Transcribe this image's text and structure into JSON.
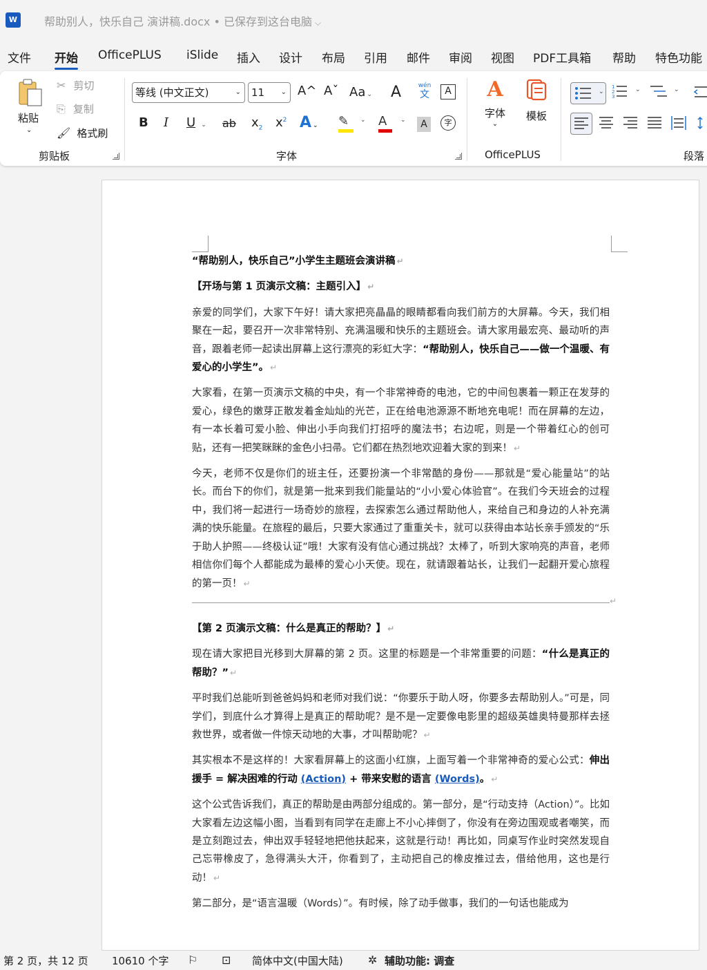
{
  "app": {
    "logo_text": "W",
    "doc_title": "帮助别人，快乐自己 演讲稿.docx • 已保存到这台电脑",
    "title_chevron": "⌵"
  },
  "menu": {
    "tabs": [
      "文件",
      "开始",
      "OfficePLUS",
      "iSlide",
      "插入",
      "设计",
      "布局",
      "引用",
      "邮件",
      "审阅",
      "视图",
      "PDF工具箱",
      "帮助",
      "特色功能"
    ],
    "active": "开始"
  },
  "ribbon": {
    "clipboard": {
      "paste": "粘贴",
      "cut": "剪切",
      "copy": "复制",
      "format_painter": "格式刷",
      "group_label": "剪贴板"
    },
    "font": {
      "font_name": "等线 (中文正文)",
      "font_size": "11",
      "grow": "A^",
      "shrink": "Aˇ",
      "change_case": "Aa",
      "clear_format": "A",
      "phonetic": "wén",
      "phonetic_char": "文",
      "char_border": "A",
      "bold": "B",
      "italic": "I",
      "underline": "U",
      "strike": "ab",
      "sub": "x",
      "sup": "x",
      "text_effect": "A",
      "font_color": "A",
      "char_shading": "A",
      "enclose": "字",
      "group_label": "字体",
      "highlight_color": "#ffe500",
      "font_color_bar": "#e00000"
    },
    "officeplus": {
      "font_btn": "字体",
      "template_btn": "模板",
      "group_label": "OfficePLUS"
    },
    "paragraph": {
      "group_label": "段落"
    }
  },
  "document": {
    "title": "“帮助别人，快乐自己”小学生主题班会演讲稿",
    "section1_heading": "【开场与第 1 页演示文稿：主题引入】",
    "p1_pre": "亲爱的同学们，大家下午好！请大家把亮晶晶的眼睛都看向我们前方的大屏幕。今天，我们相聚在一起，要召开一次非常特别、充满温暖和快乐的主题班会。请大家用最宏亮、最动听的声音，跟着老师一起读出屏幕上这行漂亮的彩虹大字：",
    "p1_bold": "“帮助别人，快乐自己——做一个温暖、有爱心的小学生”",
    "p1_post": "。",
    "p2": "大家看，在第一页演示文稿的中央，有一个非常神奇的电池，它的中间包裹着一颗正在发芽的爱心，绿色的嫩芽正散发着金灿灿的光芒，正在给电池源源不断地充电呢！而在屏幕的左边，有一本长着可爱小脸、伸出小手向我们打招呼的魔法书；右边呢，则是一个带着红心的创可贴，还有一把笑眯眯的金色小扫帚。它们都在热烈地欢迎着大家的到来！",
    "p3": "今天，老师不仅是你们的班主任，还要扮演一个非常酷的身份——那就是“爱心能量站”的站长。而台下的你们，就是第一批来到我们能量站的“小小爱心体验官”。在我们今天班会的过程中，我们将一起进行一场奇妙的旅程，去探索怎么通过帮助他人，来给自己和身边的人补充满满的快乐能量。在旅程的最后，只要大家通过了重重关卡，就可以获得由本站长亲手颁发的“乐于助人护照——终极认证”哦！大家有没有信心通过挑战？太棒了，听到大家响亮的声音，老师相信你们每个人都能成为最棒的爱心小天使。现在，就请跟着站长，让我们一起翻开爱心旅程的第一页！",
    "section2_heading": "【第 2 页演示文稿：什么是真正的帮助？】",
    "p4_pre": "现在请大家把目光移到大屏幕的第 2 页。这里的标题是一个非常重要的问题：",
    "p4_bold": "“什么是真正的帮助？”",
    "p5": "平时我们总能听到爸爸妈妈和老师对我们说：“你要乐于助人呀，你要多去帮助别人。”可是，同学们，到底什么才算得上是真正的帮助呢？是不是一定要像电影里的超级英雄奥特曼那样去拯救世界，或者做一件惊天动地的大事，才叫帮助呢？",
    "p6_pre": "其实根本不是这样的！大家看屏幕上的这面小红旗，上面写着一个非常神奇的爱心公式：",
    "p6_b1": "伸出援手 = 解决困难的行动 ",
    "p6_u1": "(Action)",
    "p6_b2": " + 带来安慰的语言 ",
    "p6_u2": "(Words)",
    "p6_post": "。",
    "p7": "这个公式告诉我们，真正的帮助是由两部分组成的。第一部分，是“行动支持（Action）”。比如大家看左边这幅小图，当看到有同学在走廊上不小心摔倒了，你没有在旁边围观或者嘲笑，而是立刻跑过去，伸出双手轻轻地把他扶起来，这就是行动！再比如，同桌写作业时突然发现自己忘带橡皮了，急得满头大汗，你看到了，主动把自己的橡皮推过去，借给他用，这也是行动！",
    "p8": "第二部分，是“语言温暖（Words）”。有时候，除了动手做事，我们的一句话也能成为",
    "para_mark": "↵"
  },
  "status": {
    "page": "第 2 页，共 12 页",
    "words": "10610 个字",
    "language": "简体中文(中国大陆)",
    "accessibility": "辅助功能: 调查"
  }
}
